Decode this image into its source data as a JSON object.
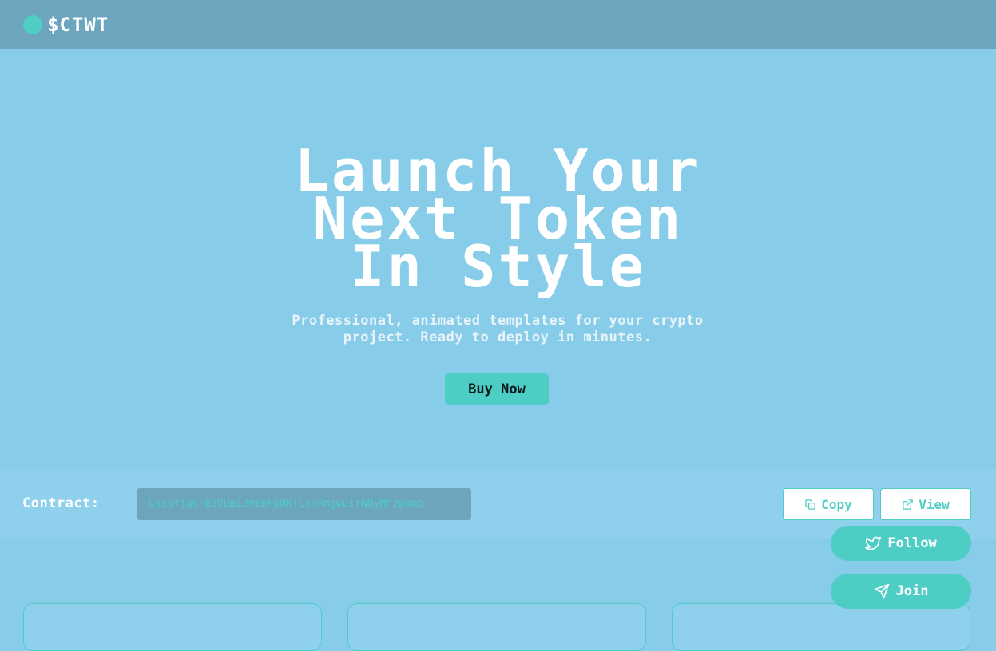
{
  "nav": {
    "brand": "$CTWT"
  },
  "hero": {
    "title_lines": [
      "Launch Your",
      "Next Token",
      "In Style"
    ],
    "subtitle_line1": "Professional, animated templates for your crypto",
    "subtitle_line2": "project. Ready to deploy in minutes.",
    "buy_label": "Buy Now"
  },
  "contract": {
    "label": "Contract:",
    "address": "GxsaYjaCFB3DDm12m8bFpNKTLc3RmgwuirN8yMnzpump",
    "copy_label": "Copy",
    "view_label": "View"
  },
  "social": {
    "follow_label": "Follow",
    "join_label": "Join"
  },
  "colors": {
    "background": "#87cce8",
    "navbar": "#6ca5bd",
    "accent": "#4ecdc4",
    "text": "#ffffff"
  },
  "icons": {
    "logo": "circle-logo-icon",
    "copy": "copy-icon",
    "view": "external-link-icon",
    "follow": "twitter-icon",
    "join": "telegram-send-icon"
  }
}
